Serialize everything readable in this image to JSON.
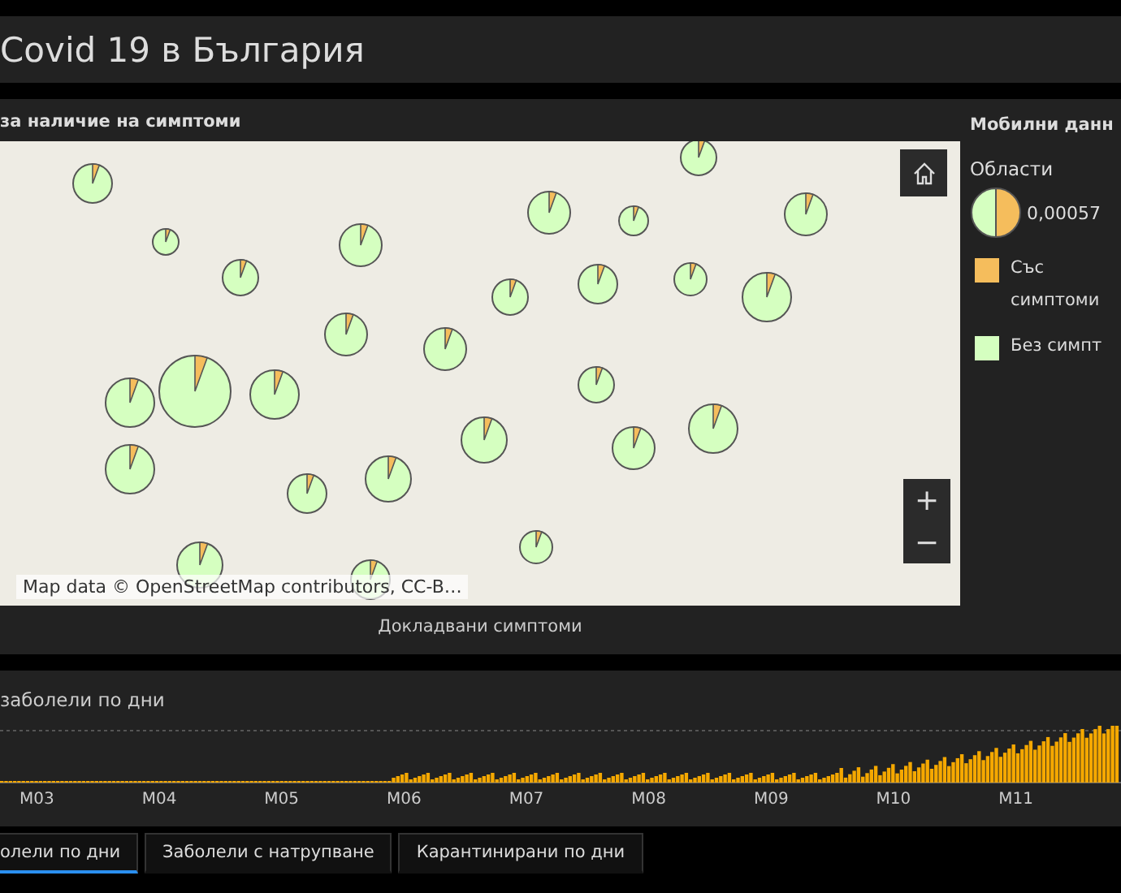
{
  "header": {
    "title": "Covid 19 в България"
  },
  "map_panel": {
    "title": "за наличие на симптоми",
    "zoom_in": "+",
    "zoom_out": "−",
    "attribution": "Map data © OpenStreetMap contributors, CC-B…",
    "caption": "Докладвани симптоми"
  },
  "legend": {
    "title": "Мобилни данн",
    "subtitle": "Области",
    "value": "0,00057",
    "items": [
      {
        "label": "Със симптоми",
        "color": "#f5bd5c"
      },
      {
        "label": "Без симпт",
        "color": "#d5ffc0"
      }
    ]
  },
  "chart_panel": {
    "title": "заболели по дни",
    "months": [
      "M03",
      "M04",
      "M05",
      "M06",
      "M07",
      "M08",
      "M09",
      "M10",
      "M11"
    ]
  },
  "tabs": [
    {
      "label": "олели по дни",
      "selected": true
    },
    {
      "label": "Заболели с натрупване",
      "selected": false
    },
    {
      "label": "Карантинирани по дни",
      "selected": false
    }
  ]
}
